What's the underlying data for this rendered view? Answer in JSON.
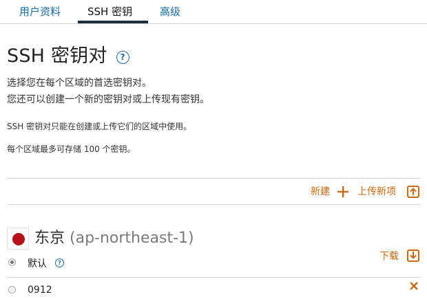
{
  "tabs": [
    {
      "label": "用户资料"
    },
    {
      "label": "SSH 密钥"
    },
    {
      "label": "高级"
    }
  ],
  "active_tab": "SSH 密钥",
  "heading": {
    "title": "SSH 密钥对",
    "help_glyph": "?"
  },
  "description": {
    "line1": "选择您在每个区域的首选密钥对。",
    "line2": "您还可以创建一个新的密钥对或上传现有密钥。"
  },
  "notes": {
    "line1": "SSH 密钥对只能在创建或上传它们的区域中使用。",
    "line2": "每个区域最多可存储 100 个密钥。"
  },
  "actions": {
    "create_label": "新建",
    "upload_label": "上传新项"
  },
  "region": {
    "name": "东京",
    "code": "(ap-northeast-1)",
    "flag": "japan-flag-icon"
  },
  "keys": [
    {
      "label": "默认",
      "selected": true,
      "download_label": "下载",
      "help_glyph": "?"
    },
    {
      "label": "0912",
      "selected": false
    }
  ],
  "colors": {
    "link_blue": "#1a6aa5",
    "accent_orange": "#c56a12",
    "tab_underline": "#1f2d3d",
    "flag_red": "#b5121b"
  }
}
